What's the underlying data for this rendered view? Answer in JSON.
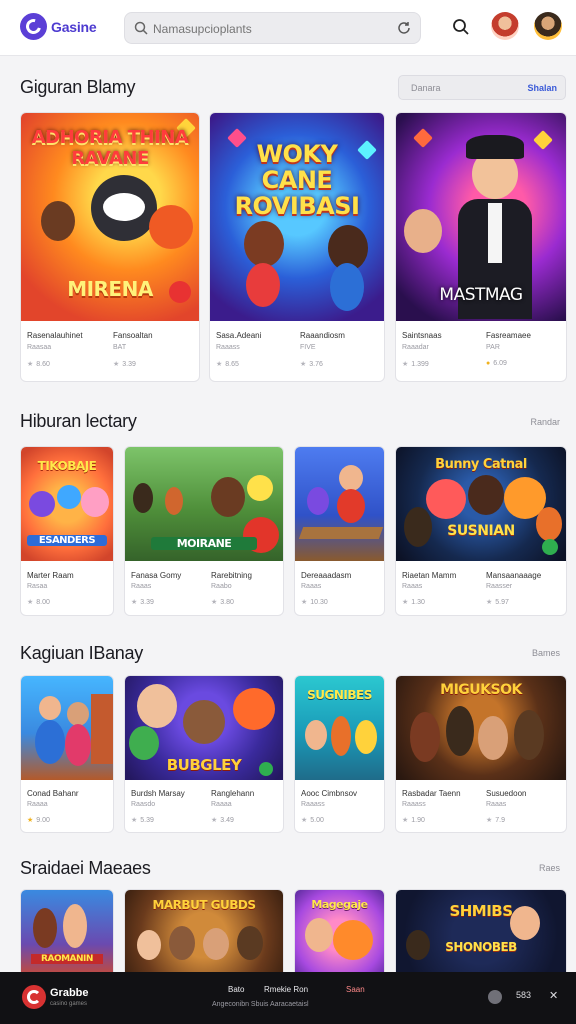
{
  "header": {
    "logo_text": "Gasine",
    "search_placeholder": "Namasupcioplants"
  },
  "sections": [
    {
      "title": "Giguran Blamy",
      "filter_value": "Danara",
      "filter_button": "Shalan",
      "cards": [
        {
          "art": "ADHORIA THINA RAVANE",
          "sub_art": "MIRENA",
          "left_title": "Rasenalauhinet",
          "left_sub": "Raasaa",
          "left_rating": "8.60",
          "right_title": "Fansoaltan",
          "right_sub": "BAT",
          "right_rating": "3.39"
        },
        {
          "art": "WOKY CANE ROVIBASI",
          "sub_art": "",
          "left_title": "Sasa.Adeani",
          "left_sub": "Raaass",
          "left_rating": "8.65",
          "right_title": "Raaandiosm",
          "right_sub": "FIVE",
          "right_rating": "3.76"
        },
        {
          "art": "MASTMAG",
          "sub_art": "",
          "left_title": "Saintsnaas",
          "left_sub": "Raaadar",
          "left_rating": "1.399",
          "right_title": "Fasreamaee",
          "right_sub": "PAR",
          "right_rating": "6.09"
        }
      ]
    },
    {
      "title": "Hiburan lectary",
      "more": "Randar",
      "cards": [
        {
          "art": "TIKOBAJE",
          "sub_art": "ESANDERS",
          "title": "Marter Raam",
          "sub": "Rasaa",
          "rating": "8.00"
        },
        {
          "art": "",
          "sub_art": "MOIRANE",
          "left_title": "Fanasa Gomy",
          "left_sub": "Raaas",
          "left_rating": "3.39",
          "right_title": "Rarebitning",
          "right_sub": "Raabo",
          "right_rating": "3.80"
        },
        {
          "art": "",
          "sub_art": "",
          "title": "Dereaaadasm",
          "sub": "Raaas",
          "rating": "10.30"
        },
        {
          "art": "Bunny Catnal",
          "sub_art": "SUSNIAN",
          "left_title": "Riaetan Mamm",
          "left_sub": "Raaas",
          "left_rating": "1.30",
          "right_title": "Mansaanaaage",
          "right_sub": "Raasser",
          "right_rating": "5.97"
        }
      ]
    },
    {
      "title": "Kagiuan IBanay",
      "more": "Bames",
      "cards": [
        {
          "art": "",
          "sub_art": "",
          "title": "Conad Bahanr",
          "sub": "Raaaa",
          "rating": "9.00"
        },
        {
          "art": "",
          "sub_art": "BUBGLEY",
          "left_title": "Burdsh Marsay",
          "left_sub": "Raasdo",
          "left_rating": "5.39",
          "right_title": "Ranglehann",
          "right_sub": "Raaaa",
          "right_rating": "3.49"
        },
        {
          "art": "SUGNIBES",
          "sub_art": "",
          "title": "Aooc Cimbnsov",
          "sub": "Raaass",
          "rating": "5.00"
        },
        {
          "art": "MIGUKSOK",
          "sub_art": "",
          "left_title": "Rasbadar Taenn",
          "left_sub": "Raaass",
          "left_rating": "1.90",
          "right_title": "Susuedoon",
          "right_sub": "Raaas",
          "right_rating": "7.9"
        }
      ]
    },
    {
      "title": "Sraidaei Maeaes",
      "more": "Raes",
      "cards": [
        {
          "art": "",
          "sub_art": "RAOMANIN"
        },
        {
          "art": "MARBUT GUBDS",
          "sub_art": ""
        },
        {
          "art": "Magegaje",
          "sub_art": ""
        },
        {
          "art": "SHMIBS",
          "sub_art": "SHONOBEB"
        }
      ]
    }
  ],
  "footer": {
    "brand": "Grabbe",
    "tagline": "casino games",
    "links": [
      "Bato",
      "Rmekie Ron",
      "Saan"
    ],
    "sub_text": "Angeconibn Sbuis Aaracaetaisl",
    "code": "583"
  },
  "colors": {
    "brand": "#4d3bd0",
    "accent_link": "#3b5bd8",
    "footer_bg": "#111114",
    "page_bg": "#f4f4f6"
  }
}
